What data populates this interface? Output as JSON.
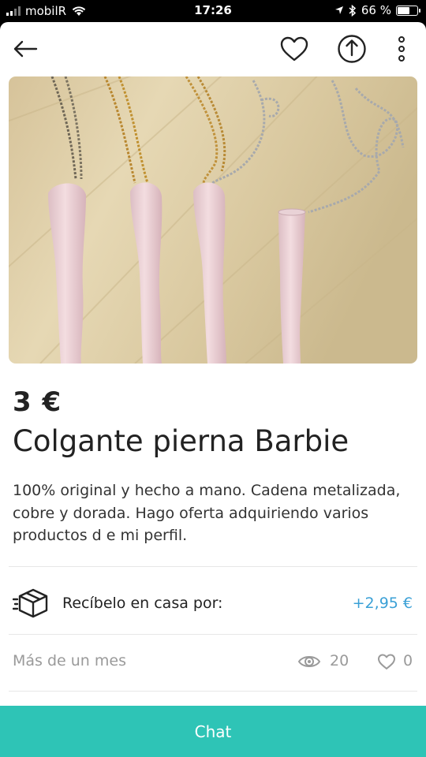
{
  "status_bar": {
    "carrier": "mobilR",
    "time": "17:26",
    "battery": "66 %",
    "battery_level": 0.66
  },
  "top_bar": {
    "icons": [
      "back-arrow-icon",
      "heart-icon",
      "share-icon",
      "more-vertical-icon"
    ]
  },
  "product": {
    "price": "3 €",
    "title": "Colgante pierna Barbie",
    "description": "100% original y hecho a mano. Cadena metalizada, cobre y dorada. Hago oferta adquiriendo varios productos d e mi perfil."
  },
  "shipping": {
    "label": "Recíbelo en casa por:",
    "price": "+2,95 €",
    "icon": "box-delivery-icon"
  },
  "meta": {
    "date": "Más de un mes",
    "views": "20",
    "favorites": "0"
  },
  "chat_button": {
    "label": "Chat",
    "color": "#2ec4b6"
  },
  "colors": {
    "accent_link": "#3aa0d6",
    "text": "#222222",
    "muted": "#9a9a9a"
  }
}
